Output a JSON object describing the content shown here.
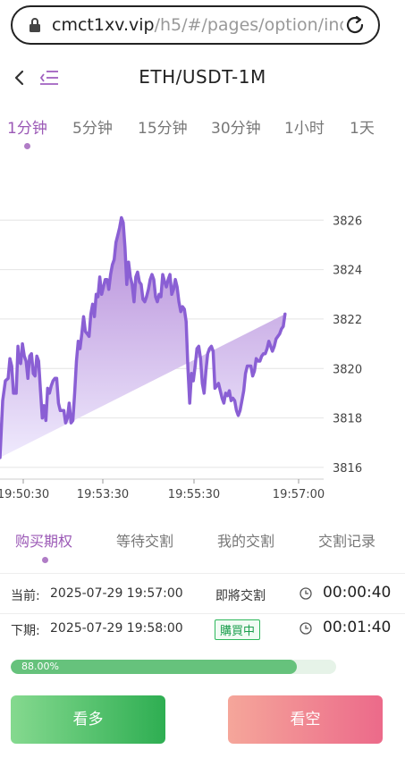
{
  "browser": {
    "url_host": "cmct1xv.vip",
    "url_path": "/h5/#/pages/option/ind"
  },
  "header": {
    "title": "ETH/USDT-1M"
  },
  "intervals": [
    {
      "label": "1分钟",
      "active": true
    },
    {
      "label": "5分钟",
      "active": false
    },
    {
      "label": "15分钟",
      "active": false
    },
    {
      "label": "30分钟",
      "active": false
    },
    {
      "label": "1小时",
      "active": false
    },
    {
      "label": "1天",
      "active": false
    }
  ],
  "chart_data": {
    "type": "area",
    "y_ticks": [
      "3826",
      "3824",
      "3822",
      "3820",
      "3818",
      "3816"
    ],
    "x_ticks": [
      "19:50:30",
      "19:53:30",
      "19:55:30",
      "19:57:00"
    ],
    "ylim": [
      3815.6,
      3827.6
    ],
    "colors": {
      "line": "#8a5fd4",
      "fill_top": "#b48ad8",
      "fill_bottom": "#efeafd"
    },
    "x": [
      0,
      3,
      6,
      9,
      11,
      13,
      15,
      18,
      20,
      21,
      23,
      25,
      27,
      29,
      31,
      33,
      35,
      37,
      39,
      41,
      43,
      45,
      47,
      49,
      51,
      53,
      55,
      57,
      59,
      61,
      63,
      65,
      67,
      69,
      71,
      73,
      75,
      77,
      79,
      81,
      83,
      85,
      87,
      89,
      91,
      93,
      95,
      97,
      99,
      101,
      103,
      105,
      107,
      109,
      111,
      113,
      115,
      117,
      119,
      121,
      123,
      125,
      127,
      129,
      131,
      133,
      135,
      137,
      139,
      141,
      143,
      145,
      147,
      149,
      151,
      153,
      155,
      157,
      159,
      161,
      163,
      165,
      167,
      169,
      171,
      173,
      175,
      177,
      179,
      181,
      183,
      185,
      187,
      189,
      191,
      193,
      195,
      197,
      199,
      201,
      203,
      205,
      207,
      209,
      211,
      213,
      215,
      217,
      219,
      221,
      223,
      225,
      227,
      229,
      231,
      233,
      235,
      237,
      239,
      241,
      243,
      245,
      247,
      249,
      251,
      253,
      255,
      257,
      259,
      261,
      263,
      265,
      267,
      269,
      271,
      273,
      275,
      277,
      279,
      281,
      283,
      285,
      287,
      289,
      291,
      293,
      295,
      297,
      299,
      301,
      303,
      305,
      307,
      309,
      311,
      313,
      315,
      317,
      319,
      321,
      323,
      325,
      327,
      329,
      331,
      333,
      335,
      337,
      339,
      341,
      343,
      345,
      347
    ],
    "y": [
      3816.4,
      3818.7,
      3819.5,
      3819.6,
      3820.4,
      3820.1,
      3819.0,
      3819.0,
      3820.9,
      3820.3,
      3820.2,
      3821.0,
      3820.5,
      3820.3,
      3819.6,
      3820.5,
      3820.6,
      3819.8,
      3819.7,
      3820.5,
      3820.3,
      3819.1,
      3818.0,
      3818.5,
      3817.9,
      3819.2,
      3819.0,
      3819.3,
      3819.5,
      3819.6,
      3819.6,
      3818.6,
      3818.3,
      3818.3,
      3818.3,
      3817.8,
      3818.0,
      3818.6,
      3817.8,
      3817.9,
      3819.0,
      3820.3,
      3821.1,
      3820.8,
      3821.4,
      3822.1,
      3821.5,
      3821.4,
      3821.3,
      3822.2,
      3822.6,
      3822.1,
      3823.0,
      3822.9,
      3823.7,
      3823.0,
      3823.3,
      3823.6,
      3823.6,
      3823.2,
      3823.8,
      3824.2,
      3824.4,
      3825.1,
      3825.4,
      3825.7,
      3826.1,
      3825.9,
      3824.9,
      3823.4,
      3824.3,
      3823.7,
      3823.4,
      3822.7,
      3823.7,
      3823.9,
      3823.5,
      3823.4,
      3822.8,
      3822.7,
      3822.9,
      3823.2,
      3823.6,
      3823.8,
      3823.6,
      3822.9,
      3822.7,
      3823.0,
      3822.9,
      3823.8,
      3823.5,
      3823.3,
      3823.6,
      3823.8,
      3823.0,
      3823.2,
      3823.6,
      3823.3,
      3822.7,
      3822.3,
      3822.5,
      3822.4,
      3821.9,
      3820.0,
      3818.6,
      3819.8,
      3819.5,
      3820.1,
      3820.8,
      3820.9,
      3820.4,
      3819.4,
      3819.0,
      3819.9,
      3820.6,
      3820.8,
      3820.9,
      3820.7,
      3819.2,
      3819.3,
      3819.4,
      3819.1,
      3818.8,
      3818.6,
      3819.0,
      3818.9,
      3819.1,
      3818.7,
      3818.8,
      3818.7,
      3818.3,
      3818.1,
      3818.3,
      3818.7,
      3819.1,
      3819.8,
      3820.1,
      3820.1,
      3820.1,
      3819.7,
      3819.9,
      3820.4,
      3820.3,
      3820.3,
      3820.5,
      3820.6,
      3820.6,
      3820.8,
      3821.1,
      3820.9,
      3820.7,
      3820.9,
      3821.2,
      3821.3,
      3821.4,
      3821.6,
      3821.7,
      3822.2
    ]
  },
  "option_tabs": [
    {
      "label": "购买期权",
      "active": true
    },
    {
      "label": "等待交割",
      "active": false
    },
    {
      "label": "我的交割",
      "active": false
    },
    {
      "label": "交割记录",
      "active": false
    }
  ],
  "current": {
    "label": "当前:",
    "time": "2025-07-29 19:57:00",
    "status": "即將交割",
    "countdown": "00:00:40"
  },
  "next": {
    "label": "下期:",
    "time": "2025-07-29 19:58:00",
    "status": "購買中",
    "countdown": "00:01:40"
  },
  "progress": {
    "value": 88.0,
    "label": "88.00%"
  },
  "actions": {
    "long_label": "看多",
    "short_label": "看空"
  }
}
